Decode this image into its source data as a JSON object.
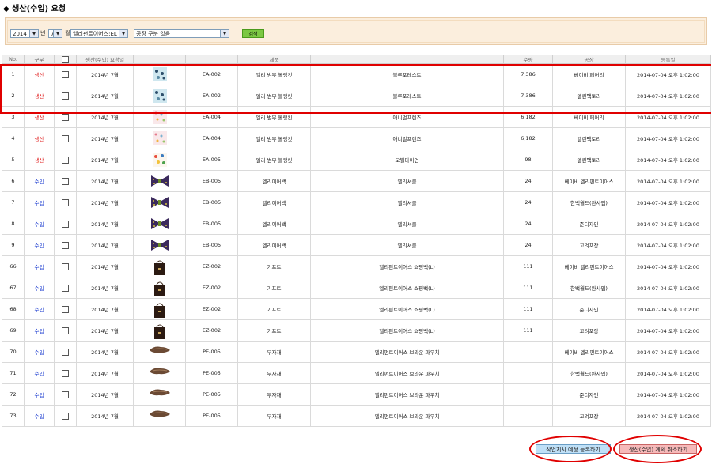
{
  "page": {
    "title": "◆ 생산(수입) 요청"
  },
  "search": {
    "year": "2014",
    "year_suffix": "년",
    "month": "7",
    "month_suffix": "월",
    "company": "엘리펀트이어스:EL",
    "factory": "공장 구분 없음",
    "search_button": "검색"
  },
  "table": {
    "columns": [
      "No.",
      "구분",
      "",
      "생산(수입) 요청일",
      "",
      "",
      "제품",
      "",
      "수량",
      "공장",
      "등록일"
    ],
    "rows": [
      {
        "no": "1",
        "type": "생산",
        "type_class": "prod",
        "date": "2014년 7월",
        "thumb": "pattern-blue",
        "code": "EA-002",
        "category": "엘리 범부 볼랭킷",
        "product": "블루포레스트",
        "qty": "7,386",
        "factory": "베이비 페어리",
        "registered": "2014-07-04 오후 1:02:00"
      },
      {
        "no": "2",
        "type": "생산",
        "type_class": "prod",
        "date": "2014년 7월",
        "thumb": "pattern-blue",
        "code": "EA-002",
        "category": "엘리 범부 볼랭킷",
        "product": "블루포레스트",
        "qty": "7,386",
        "factory": "엘린팩토리",
        "registered": "2014-07-04 오후 1:02:00"
      },
      {
        "no": "3",
        "type": "생산",
        "type_class": "prod",
        "date": "2014년 7월",
        "thumb": "pattern-pink",
        "code": "EA-004",
        "category": "엘리 범부 볼랭킷",
        "product": "애니멀프렌즈",
        "qty": "6,182",
        "factory": "베이비 페어리",
        "registered": "2014-07-04 오후 1:02:00"
      },
      {
        "no": "4",
        "type": "생산",
        "type_class": "prod",
        "date": "2014년 7월",
        "thumb": "pattern-pink",
        "code": "EA-004",
        "category": "엘리 범부 볼랭킷",
        "product": "애니멀프렌즈",
        "qty": "6,182",
        "factory": "엘린팩토리",
        "registered": "2014-07-04 오후 1:02:00"
      },
      {
        "no": "5",
        "type": "생산",
        "type_class": "prod",
        "date": "2014년 7월",
        "thumb": "pattern-multi",
        "code": "EA-005",
        "category": "엘리 범부 볼랭킷",
        "product": "오뷀다이언",
        "qty": "98",
        "factory": "엘린팩토리",
        "registered": "2014-07-04 오후 1:02:00"
      },
      {
        "no": "6",
        "type": "수입",
        "type_class": "imp",
        "date": "2014년 7월",
        "thumb": "bow-bag",
        "code": "EB-005",
        "category": "엘리이어백",
        "product": "엘리셔클",
        "qty": "24",
        "factory": "베이비 엘리펀트이어스",
        "registered": "2014-07-04 오후 1:02:00"
      },
      {
        "no": "7",
        "type": "수입",
        "type_class": "imp",
        "date": "2014년 7월",
        "thumb": "bow-bag",
        "code": "EB-005",
        "category": "엘리이어백",
        "product": "엘리셔클",
        "qty": "24",
        "factory": "한백월드(완사입)",
        "registered": "2014-07-04 오후 1:02:00"
      },
      {
        "no": "8",
        "type": "수입",
        "type_class": "imp",
        "date": "2014년 7월",
        "thumb": "bow-bag",
        "code": "EB-005",
        "category": "엘리이어백",
        "product": "엘리셔클",
        "qty": "24",
        "factory": "준디자인",
        "registered": "2014-07-04 오후 1:02:00"
      },
      {
        "no": "9",
        "type": "수입",
        "type_class": "imp",
        "date": "2014년 7월",
        "thumb": "bow-bag",
        "code": "EB-005",
        "category": "엘리이어백",
        "product": "엘리셔클",
        "qty": "24",
        "factory": "고려포장",
        "registered": "2014-07-04 오후 1:02:00"
      },
      {
        "no": "66",
        "type": "수입",
        "type_class": "imp",
        "date": "2014년 7월",
        "thumb": "shopping-bag",
        "code": "EZ-002",
        "category": "기프트",
        "product": "엘리펀트이어스 쇼핑백(L)",
        "qty": "111",
        "factory": "베이비 엘리펀트이어스",
        "registered": "2014-07-04 오후 1:02:00"
      },
      {
        "no": "67",
        "type": "수입",
        "type_class": "imp",
        "date": "2014년 7월",
        "thumb": "shopping-bag",
        "code": "EZ-002",
        "category": "기프트",
        "product": "엘리펀트이어스 쇼핑백(L)",
        "qty": "111",
        "factory": "한백월드(완사입)",
        "registered": "2014-07-04 오후 1:02:00"
      },
      {
        "no": "68",
        "type": "수입",
        "type_class": "imp",
        "date": "2014년 7월",
        "thumb": "shopping-bag",
        "code": "EZ-002",
        "category": "기프트",
        "product": "엘리펀트이어스 쇼핑백(L)",
        "qty": "111",
        "factory": "준디자인",
        "registered": "2014-07-04 오후 1:02:00"
      },
      {
        "no": "69",
        "type": "수입",
        "type_class": "imp",
        "date": "2014년 7월",
        "thumb": "shopping-bag",
        "code": "EZ-002",
        "category": "기프트",
        "product": "엘리펀트이어스 쇼핑백(L)",
        "qty": "111",
        "factory": "고려포장",
        "registered": "2014-07-04 오후 1:02:00"
      },
      {
        "no": "70",
        "type": "수입",
        "type_class": "imp",
        "date": "2014년 7월",
        "thumb": "pouch",
        "code": "PE-005",
        "category": "부자재",
        "product": "엘리펀트이어스 브라운 파우치",
        "qty": "",
        "factory": "베이비 엘리펀트이어스",
        "registered": "2014-07-04 오후 1:02:00"
      },
      {
        "no": "71",
        "type": "수입",
        "type_class": "imp",
        "date": "2014년 7월",
        "thumb": "pouch",
        "code": "PE-005",
        "category": "부자재",
        "product": "엘리펀트이어스 브라운 파우치",
        "qty": "",
        "factory": "한백월드(완사입)",
        "registered": "2014-07-04 오후 1:02:00"
      },
      {
        "no": "72",
        "type": "수입",
        "type_class": "imp",
        "date": "2014년 7월",
        "thumb": "pouch",
        "code": "PE-005",
        "category": "부자재",
        "product": "엘리펀트이어스 브라운 파우치",
        "qty": "",
        "factory": "준디자인",
        "registered": "2014-07-04 오후 1:02:00"
      },
      {
        "no": "73",
        "type": "수입",
        "type_class": "imp",
        "date": "2014년 7월",
        "thumb": "pouch",
        "code": "PE-005",
        "category": "부자재",
        "product": "엘리펀트이어스 브라운 파우치",
        "qty": "",
        "factory": "고려포장",
        "registered": "2014-07-04 오후 1:02:00"
      }
    ]
  },
  "actions": {
    "register_label": "작업지시 예정 등록하기",
    "cancel_label": "생산(수입) 계획 취소하기"
  },
  "colors": {
    "production": "#e02020",
    "import": "#1f3fd0",
    "highlight": "#e00000",
    "search_button": "#7cc843"
  }
}
